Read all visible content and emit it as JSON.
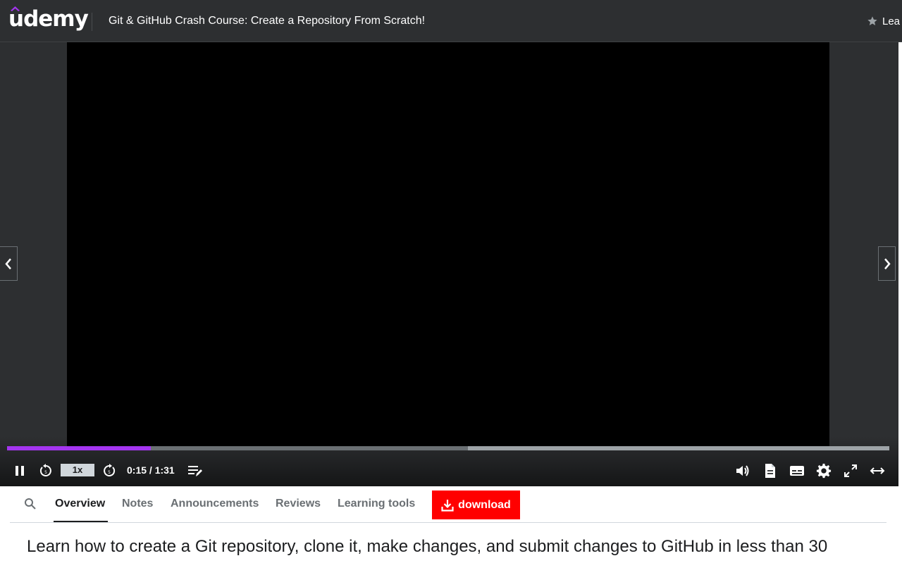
{
  "header": {
    "logo_text": "udemy",
    "course_title": "Git & GitHub Crash Course: Create a Repository From Scratch!",
    "rating_label": "Lea"
  },
  "player": {
    "speed": "1x",
    "time_display": "0:15 / 1:31",
    "progress_played_fraction": 0.163,
    "progress_buffered_fraction": 0.522,
    "icons": [
      "pause-icon",
      "rewind-icon",
      "forward-icon",
      "notes-icon",
      "volume-icon",
      "transcript-icon",
      "captions-icon",
      "settings-icon",
      "fullscreen-icon",
      "expand-icon"
    ]
  },
  "tabs": {
    "items": [
      "Overview",
      "Notes",
      "Announcements",
      "Reviews",
      "Learning tools"
    ],
    "active": "Overview",
    "download_label": "download"
  },
  "description": "Learn how to create a Git repository, clone it, make changes, and submit changes to GitHub in less than 30",
  "colors": {
    "accent": "#a435f0",
    "download": "#ff0000",
    "dark": "#2d2f31"
  }
}
